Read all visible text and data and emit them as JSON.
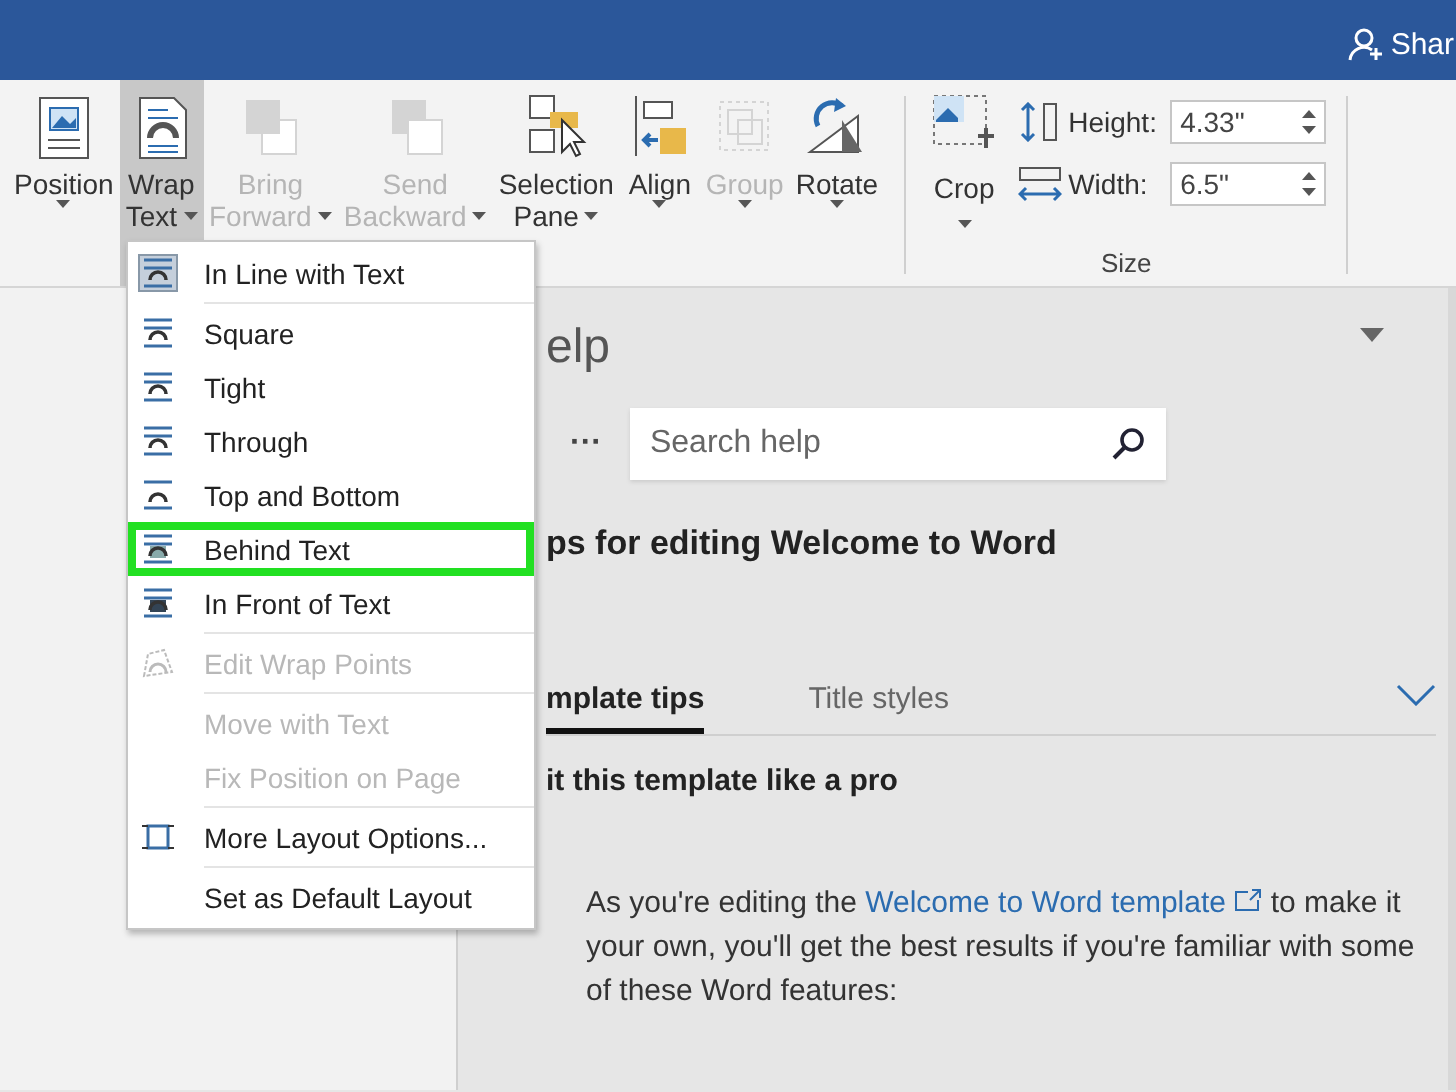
{
  "title_bar": {
    "share_label": "Shar"
  },
  "ribbon": {
    "buttons": [
      {
        "lines": [
          "Position"
        ],
        "disabled": false,
        "selected": false
      },
      {
        "lines": [
          "Wrap",
          "Text"
        ],
        "disabled": false,
        "selected": true
      },
      {
        "lines": [
          "Bring",
          "Forward"
        ],
        "disabled": true,
        "selected": false
      },
      {
        "lines": [
          "Send",
          "Backward"
        ],
        "disabled": true,
        "selected": false
      },
      {
        "lines": [
          "Selection",
          "Pane"
        ],
        "disabled": false,
        "selected": false
      },
      {
        "lines": [
          "Align"
        ],
        "disabled": false,
        "selected": false
      },
      {
        "lines": [
          "Group"
        ],
        "disabled": true,
        "selected": false
      },
      {
        "lines": [
          "Rotate"
        ],
        "disabled": false,
        "selected": false
      }
    ],
    "crop": {
      "label": "Crop"
    },
    "size_fields": [
      {
        "label": "Height:",
        "value": "4.33\""
      },
      {
        "label": "Width:",
        "value": "6.5\""
      }
    ],
    "group_label": "Size"
  },
  "wrap_menu": {
    "items": [
      {
        "kind": "option",
        "label": "In Line with Text",
        "disabled": false,
        "selected": true,
        "highlighted": false
      },
      {
        "kind": "option",
        "label": "Square",
        "disabled": false,
        "selected": false,
        "highlighted": false
      },
      {
        "kind": "option",
        "label": "Tight",
        "disabled": false,
        "selected": false,
        "highlighted": false
      },
      {
        "kind": "option",
        "label": "Through",
        "disabled": false,
        "selected": false,
        "highlighted": false
      },
      {
        "kind": "option",
        "label": "Top and Bottom",
        "disabled": false,
        "selected": false,
        "highlighted": false
      },
      {
        "kind": "option",
        "label": "Behind Text",
        "disabled": false,
        "selected": false,
        "highlighted": true
      },
      {
        "kind": "option",
        "label": "In Front of Text",
        "disabled": false,
        "selected": false,
        "highlighted": false
      },
      {
        "kind": "edit",
        "label": "Edit Wrap Points",
        "disabled": true,
        "selected": false,
        "highlighted": false
      },
      {
        "kind": "plain",
        "label": "Move with Text",
        "disabled": true,
        "selected": false,
        "highlighted": false
      },
      {
        "kind": "plain",
        "label": "Fix Position on Page",
        "disabled": true,
        "selected": false,
        "highlighted": false
      },
      {
        "kind": "layout",
        "label": "More Layout Options...",
        "disabled": false,
        "selected": false,
        "highlighted": false
      },
      {
        "kind": "plain",
        "label": "Set as Default Layout",
        "disabled": false,
        "selected": false,
        "highlighted": false
      }
    ]
  },
  "help_pane": {
    "title": "elp",
    "more_label": "···",
    "search": {
      "placeholder": "Search help"
    },
    "heading": "ps for editing Welcome to Word",
    "tabs": [
      {
        "label": "mplate tips",
        "selected": true
      },
      {
        "label": "Title styles",
        "selected": false
      }
    ],
    "section_title": "it this template like a pro",
    "paragraph": {
      "before": "As you're editing the ",
      "link": "Welcome to Word template",
      "after": " to make it your own, you'll get the best results if you're familiar with some of these Word features:"
    }
  }
}
